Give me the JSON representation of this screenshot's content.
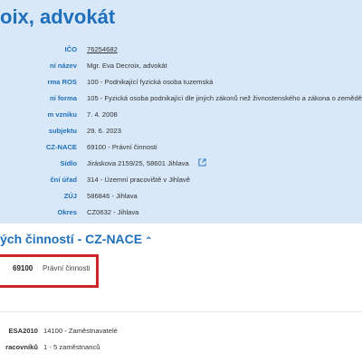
{
  "header": {
    "title": "oix, advokát"
  },
  "details": [
    {
      "label": "IČO",
      "value": "76254682"
    },
    {
      "label": "ní název",
      "value": "Mgr. Eva Decroix, advokát"
    },
    {
      "label": "rma ROS",
      "value": "100 - Podnikající fyzická osoba tuzemská"
    },
    {
      "label": "ní forma",
      "value": "105 - Fyzická osoba podnikající dle jiných zákonů než živnostenského a zákona o zemědělství"
    },
    {
      "label": "m vzniku",
      "value": "7. 4. 2008"
    },
    {
      "label": "subjektu",
      "value": "29. 6. 2023"
    },
    {
      "label": "CZ-NACE",
      "value": "69100 - Právní činnosti"
    },
    {
      "label": "Sídlo",
      "value": "Jiráskova 2159/25, 58601 Jihlava",
      "icon": "external-link-icon"
    },
    {
      "label": "ční úřad",
      "value": "314 - Územní pracoviště v Jihlavě"
    },
    {
      "label": "ZÚJ",
      "value": "586846 - Jihlava"
    },
    {
      "label": "Okres",
      "value": "CZ0632 - Jihlava"
    }
  ],
  "activities_section": {
    "heading": "ých činností - CZ-NACE",
    "chevron": "⌃",
    "items": [
      {
        "code": "69100",
        "name": "Právní činnosti"
      }
    ]
  },
  "statistics": [
    {
      "label": "ESA2010",
      "value": "14100 - Zaměstnavatelé"
    },
    {
      "label": "racovníků",
      "value": "1 - 5 zaměstnanců"
    }
  ],
  "colors": {
    "panel": "#d8e8f8",
    "accent": "#1f6fba",
    "highlight": "#d0242b"
  }
}
